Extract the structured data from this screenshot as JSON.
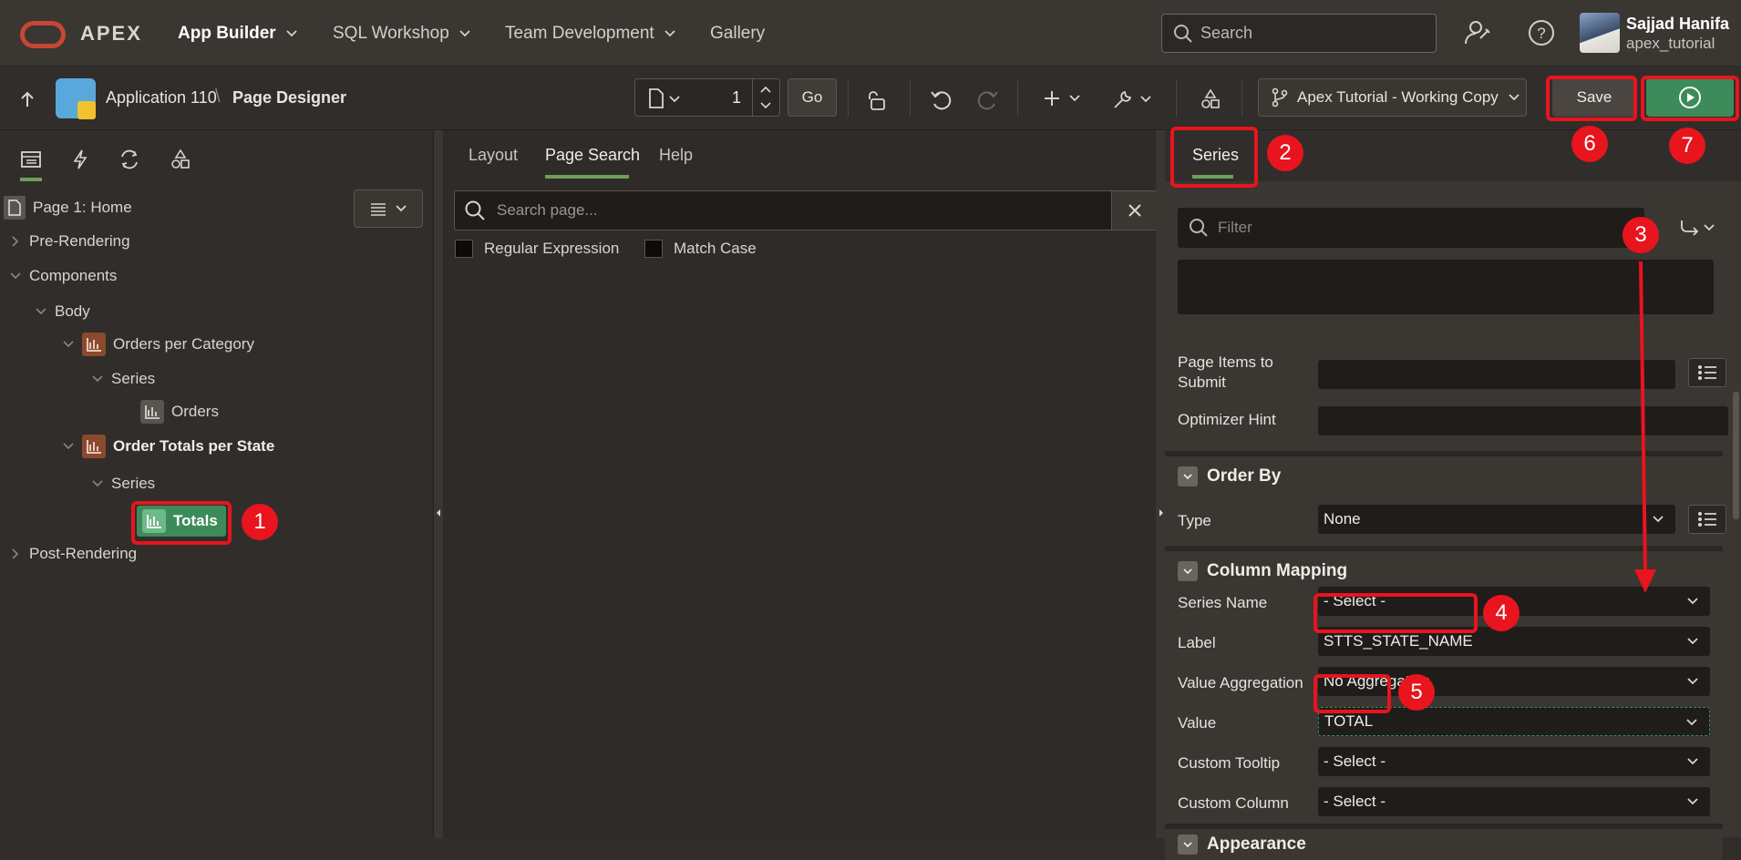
{
  "topnav": {
    "brand": "APEX",
    "items": [
      {
        "label": "App Builder"
      },
      {
        "label": "SQL Workshop"
      },
      {
        "label": "Team Development"
      },
      {
        "label": "Gallery"
      }
    ],
    "search_placeholder": "Search",
    "user": {
      "name": "Sajjad Hanifa",
      "workspace": "apex_tutorial"
    }
  },
  "toolbar": {
    "app_name": "Application 110",
    "breadcrumb_sep": "\\",
    "page_title": "Page Designer",
    "page_number": "1",
    "go_label": "Go",
    "working_copy": "Apex Tutorial - Working Copy",
    "save_label": "Save"
  },
  "left_tree": {
    "page": "Page 1: Home",
    "pre_rendering": "Pre-Rendering",
    "components": "Components",
    "body": "Body",
    "region1": "Orders per Category",
    "series1": "Series",
    "series1_item": "Orders",
    "region2": "Order Totals per State",
    "series2": "Series",
    "series2_item": "Totals",
    "post_rendering": "Post-Rendering"
  },
  "middle": {
    "tabs": [
      "Layout",
      "Page Search",
      "Help"
    ],
    "active_tab": "Page Search",
    "search_placeholder": "Search page...",
    "regex_label": "Regular Expression",
    "match_case_label": "Match Case"
  },
  "right": {
    "tab": "Series",
    "filter_placeholder": "Filter",
    "page_items_label": "Page Items to Submit",
    "optimizer_label": "Optimizer Hint",
    "order_by_title": "Order By",
    "type_label": "Type",
    "type_value": "None",
    "column_mapping_title": "Column Mapping",
    "series_name_label": "Series Name",
    "series_name_value": "- Select -",
    "label_label": "Label",
    "label_value": "STTS_STATE_NAME",
    "aggregation_label": "Value Aggregation",
    "aggregation_value": "No Aggregation",
    "value_label": "Value",
    "value_value": "TOTAL",
    "tooltip_label": "Custom Tooltip",
    "tooltip_value": "- Select -",
    "custom_col_label": "Custom Column",
    "custom_col_value": "- Select -",
    "appearance_title": "Appearance"
  },
  "annotations": [
    "1",
    "2",
    "3",
    "4",
    "5",
    "6",
    "7"
  ],
  "colors": {
    "accent_green": "#3d8b5a",
    "annotation_red": "#e8141e",
    "oracle_red": "#c74634"
  }
}
